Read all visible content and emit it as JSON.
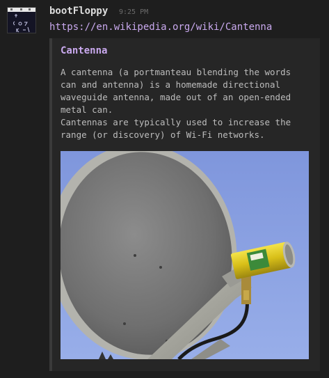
{
  "message": {
    "author": "bootFloppy",
    "timestamp": "9:25 PM",
    "link": "https://en.wikipedia.org/wiki/Cantenna",
    "avatar_icon": "bot-avatar-icon"
  },
  "embed": {
    "title": "Cantenna",
    "description": "A cantenna (a portmanteau blending the words\ncan and antenna) is a homemade directional\nwaveguide antenna, made out of an open-ended\nmetal can.\nCantennas are typically used to increase the\nrange (or discovery) of Wi-Fi networks.",
    "image_alt": "Cantenna attached to a satellite dish"
  },
  "colors": {
    "background": "#1e1e1e",
    "embed_background": "#262626",
    "link": "#c9a9ee",
    "text": "#bdbdbd"
  }
}
